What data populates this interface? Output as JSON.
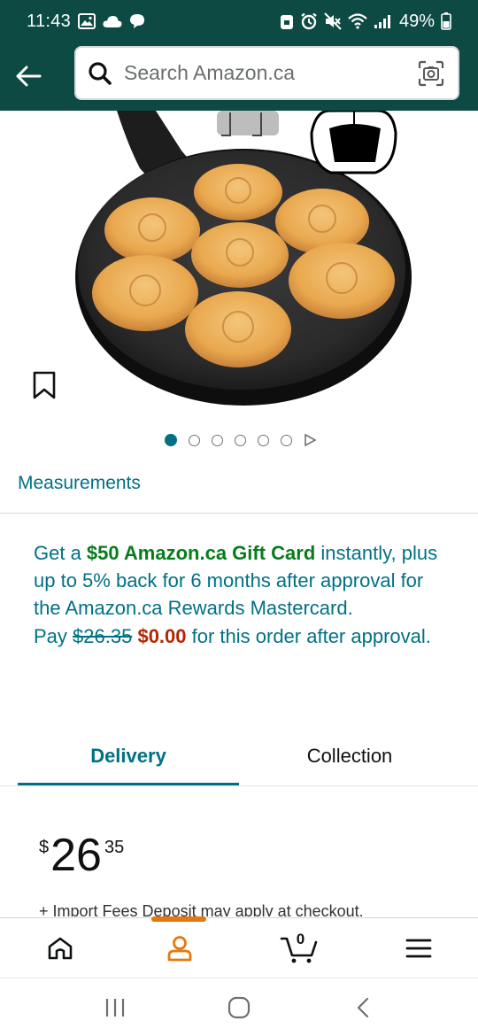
{
  "status_bar": {
    "time": "11:43",
    "battery": "49%",
    "left_icons": [
      "gallery-icon",
      "cloud-icon",
      "chat-icon"
    ],
    "right_icons": [
      "lock-icon",
      "alarm-icon",
      "mute-icon",
      "wifi-icon",
      "signal-icon",
      "battery-icon"
    ]
  },
  "header": {
    "search_placeholder": "Search Amazon.ca",
    "back_icon": "arrow-left-icon",
    "search_icon": "magnifier-icon",
    "camera_icon": "camera-lens-icon"
  },
  "carousel": {
    "total_dots": 6,
    "active_index": 0,
    "has_video_play": true
  },
  "measurements_link": "Measurements",
  "promo": {
    "prefix": "Get a ",
    "highlight": "$50 Amazon.ca Gift Card",
    "body": " instantly, plus up to 5% back for 6 months after approval for the Amazon.ca Rewards Mastercard.",
    "pay_prefix": "Pay ",
    "old_price": "$26.35",
    "new_price": "$0.00",
    "pay_suffix": " for this order after approval."
  },
  "tabs": [
    {
      "label": "Delivery",
      "active": true
    },
    {
      "label": "Collection",
      "active": false
    }
  ],
  "price": {
    "currency": "$",
    "whole": "26",
    "fraction": "35"
  },
  "import_note": "+ Import Fees Deposit may apply at checkout.",
  "bottom_nav": {
    "items": [
      "home-icon",
      "account-icon",
      "cart-icon",
      "menu-icon"
    ],
    "active_index": 1,
    "cart_count": "0"
  },
  "colors": {
    "header_bg": "#0d4a43",
    "link": "#007185",
    "green": "#067d1b",
    "deal_red": "#b12704",
    "active_nav": "#e47911"
  }
}
